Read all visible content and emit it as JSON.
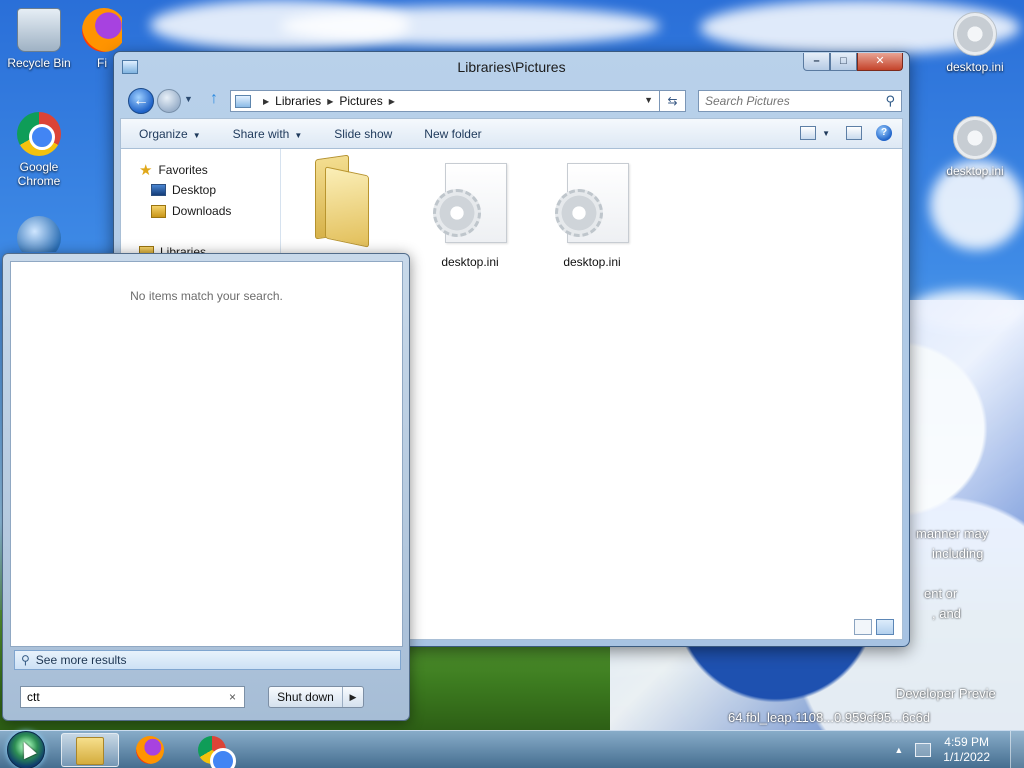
{
  "desktop": {
    "icons": [
      {
        "label": "Recycle Bin",
        "icon": "recycle-bin-icon"
      },
      {
        "label": "Fi",
        "icon": "firefox-icon"
      },
      {
        "label": "Google Chrome",
        "icon": "chrome-icon"
      },
      {
        "label": "desktop.ini",
        "icon": "settings-file-icon"
      },
      {
        "label": "desktop.ini",
        "icon": "settings-file-icon"
      }
    ],
    "watermark": [
      "manner may",
      "including",
      "",
      "ent or",
      ", and",
      "Developer Previe",
      "64.fbl_leap.1108...0.959cf95...6c6d"
    ]
  },
  "explorer": {
    "title": "Libraries\\Pictures",
    "breadcrumb": [
      "Libraries",
      "Pictures"
    ],
    "search_placeholder": "Search Pictures",
    "toolbar": {
      "organize": "Organize",
      "share_with": "Share with",
      "slide_show": "Slide show",
      "new_folder": "New folder"
    },
    "nav": {
      "favorites": "Favorites",
      "desktop": "Desktop",
      "downloads": "Downloads",
      "libraries": "Libraries"
    },
    "files": [
      {
        "name": "",
        "type": "folder"
      },
      {
        "name": "desktop.ini",
        "type": "settings-file"
      },
      {
        "name": "desktop.ini",
        "type": "settings-file"
      }
    ]
  },
  "start_menu": {
    "no_results": "No items match your search.",
    "see_more": "See more results",
    "search_value": "ctt",
    "clear_glyph": "×",
    "shutdown_label": "Shut down"
  },
  "taskbar": {
    "time": "4:59 PM",
    "date": "1/1/2022"
  },
  "colors": {
    "accent": "#1f63c9",
    "window_frame": "#b9d1ea",
    "taskbar": "#466e96"
  }
}
